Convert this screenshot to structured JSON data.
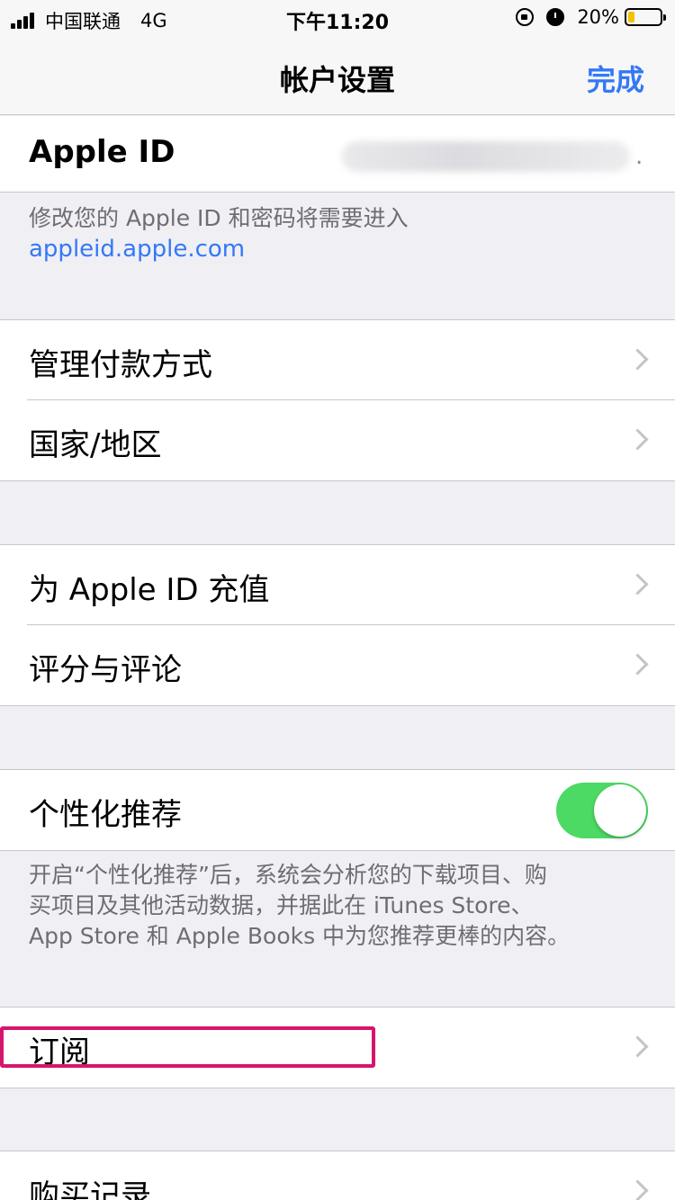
{
  "status_bar": {
    "carrier": "中国联通",
    "network": "4G",
    "time": "下午11:20",
    "battery_percent": "20%",
    "battery_level": 0.2,
    "icons": [
      "signal-icon",
      "orientation-lock-icon",
      "alarm-icon",
      "battery-icon"
    ]
  },
  "nav": {
    "title": "帐户设置",
    "done_label": "完成"
  },
  "apple_id": {
    "label": "Apple ID",
    "trailing": "."
  },
  "apple_id_footer": {
    "text": "修改您的 Apple ID 和密码将需要进入",
    "link": "appleid.apple.com"
  },
  "group1": {
    "items": [
      "管理付款方式",
      "国家/地区"
    ]
  },
  "group2": {
    "items": [
      "为 Apple ID 充值",
      "评分与评论"
    ]
  },
  "personalized": {
    "label": "个性化推荐",
    "toggle_on": true,
    "footer_lines": [
      "开启“个性化推荐”后，系统会分析您的下载项目、购",
      "买项目及其他活动数据，并据此在 iTunes Store、",
      "App Store 和 Apple Books 中为您推荐更棒的内容。"
    ]
  },
  "group3": {
    "items": [
      "订阅"
    ]
  },
  "group4": {
    "items": [
      "购买记录"
    ]
  },
  "colors": {
    "accent": "#3478f6",
    "toggle_on": "#4cd964",
    "highlight": "#d8156c",
    "background": "#efeff4"
  }
}
